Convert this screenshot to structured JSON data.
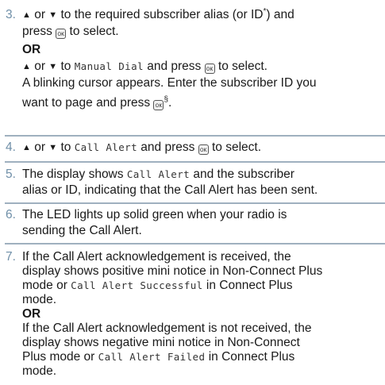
{
  "colors": {
    "step_number": "#6f8fa8",
    "rule": "#9fb0bf"
  },
  "icons": {
    "up": "▲",
    "down": "▼",
    "ok_button": "ok-menu-button-icon"
  },
  "ok_glyph": "OK",
  "steps": [
    {
      "number": "3.",
      "line1_a": " or ",
      "line1_b": " to the required subscriber alias (or ID",
      "line1_sup": "*",
      "line1_c": ") and",
      "line2_a": "press ",
      "line2_b": " to select.",
      "or_1": "OR",
      "line4_a": " or ",
      "line4_b": " to ",
      "line4_mono": "Manual Dial",
      "line4_c": " and press ",
      "line4_d": " to select.",
      "line5": "A blinking cursor appears. Enter the subscriber ID you",
      "line6_a": "want to page and press ",
      "line6_sup": "§",
      "line6_b": "."
    },
    {
      "number": "4.",
      "a": " or ",
      "b": " to ",
      "mono": "Call Alert",
      "c": " and press ",
      "d": " to select."
    },
    {
      "number": "5.",
      "line1_a": "The display shows ",
      "line1_mono": "Call Alert",
      "line1_b": " and the subscriber",
      "line2": "alias or ID, indicating that the Call Alert has been sent."
    },
    {
      "number": "6.",
      "line1": "The LED lights up solid green when your radio is",
      "line2": "sending the Call Alert."
    },
    {
      "number": "7.",
      "line1": "If the Call Alert acknowledgement is received, the",
      "line2": "display shows positive mini notice in Non-Connect Plus",
      "line3_a": "mode or ",
      "line3_mono": "Call Alert Successful",
      "line3_b": " in Connect Plus",
      "line4": "mode.",
      "or_2": "OR",
      "line6": "If the Call Alert acknowledgement is not received, the",
      "line7": "display shows negative mini notice in Non-Connect",
      "line8_a": "Plus mode or ",
      "line8_mono": "Call Alert Failed",
      "line8_b": " in Connect Plus",
      "line9": "mode."
    }
  ]
}
